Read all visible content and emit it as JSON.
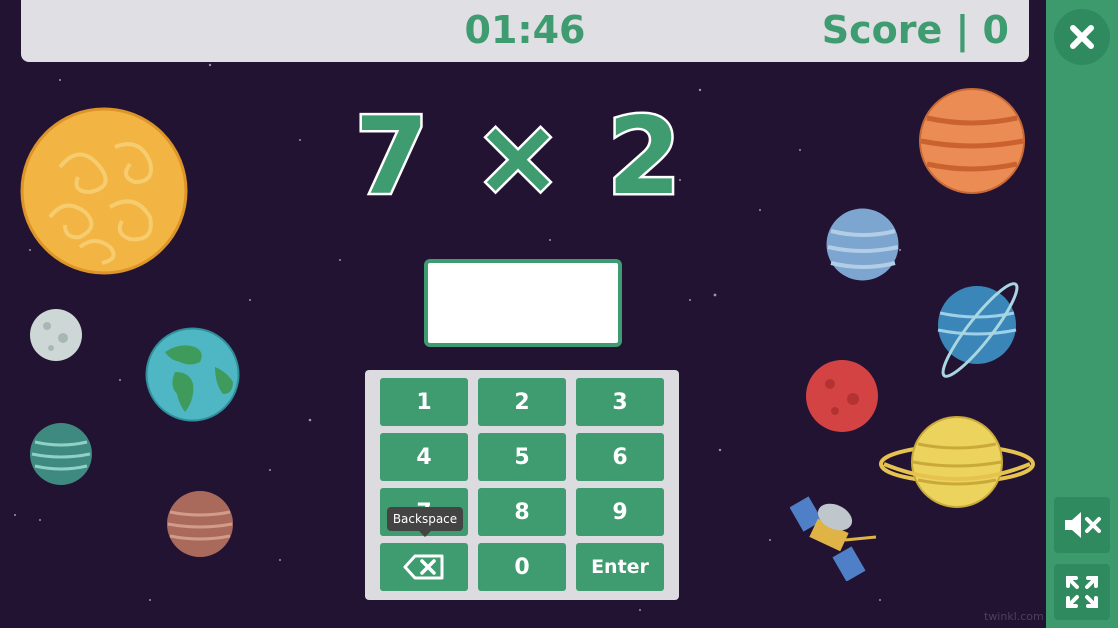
{
  "header": {
    "timer": "01:46",
    "score_label": "Score | 0"
  },
  "question": {
    "text": "7 × 2"
  },
  "answer": {
    "value": ""
  },
  "keypad": {
    "keys": [
      "1",
      "2",
      "3",
      "4",
      "5",
      "6",
      "7",
      "8",
      "9",
      "",
      "0",
      "Enter"
    ],
    "backspace_tooltip": "Backspace"
  },
  "sidebar": {
    "close_icon": "close-icon",
    "mute_icon": "mute-icon",
    "fullscreen_icon": "fullscreen-icon"
  },
  "watermark": "twinkl.com",
  "colors": {
    "background": "#231333",
    "accent": "#3f9b70",
    "sidebar": "#3d9a6c"
  }
}
